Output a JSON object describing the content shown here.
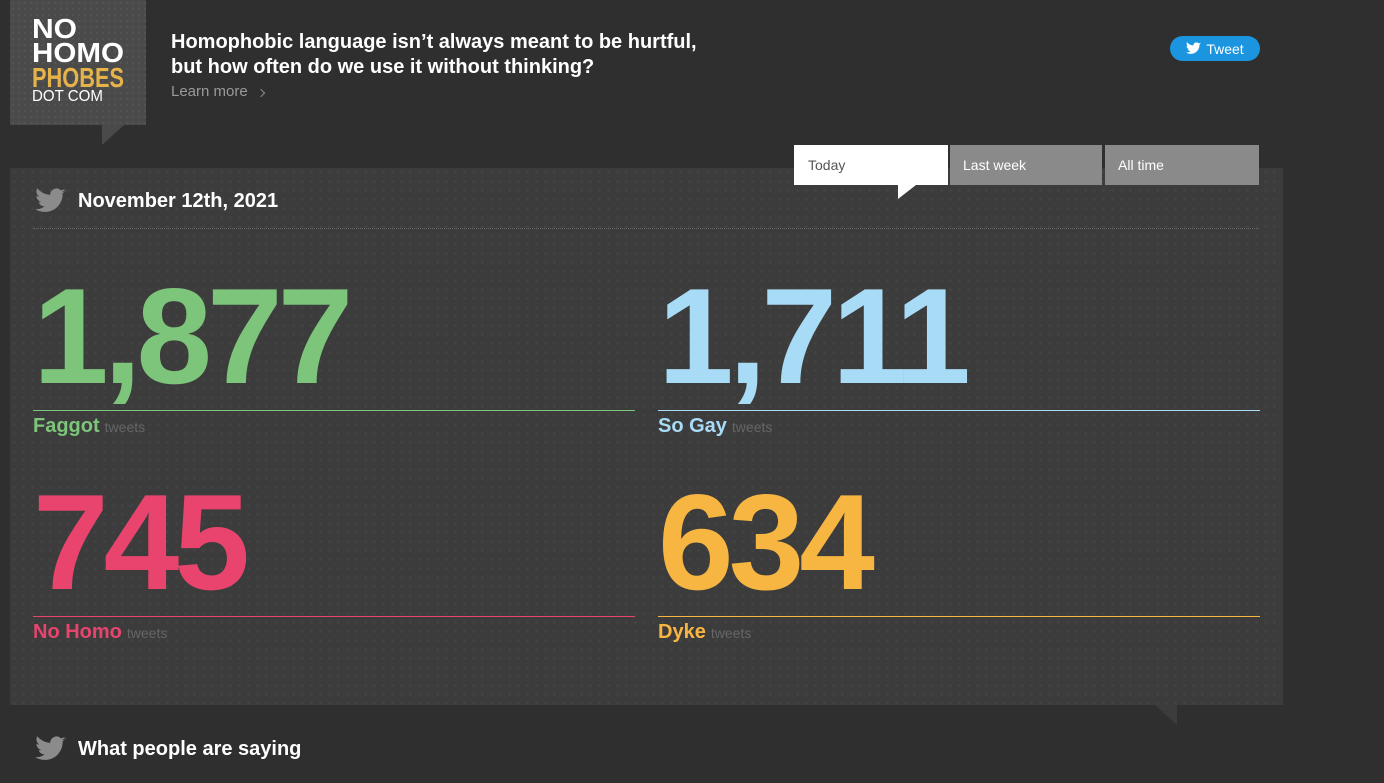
{
  "logo": {
    "line_1": "NO",
    "line_2": "HOMO",
    "line_3": "PHOBES",
    "line_4": "DOT COM",
    "accent_color": "#e6b34a"
  },
  "header": {
    "headline": [
      "Homophobic language isn’t always meant to be hurtful,",
      "but how often do we use it without thinking?"
    ],
    "learn_more": "Learn more",
    "learn_more_icon": "chevron-right-icon"
  },
  "tweet_button": {
    "label": "Tweet",
    "icon": "twitter-bird-icon",
    "color": "#1b95e0"
  },
  "tabs": {
    "items": [
      {
        "label": "Today",
        "selected": true
      },
      {
        "label": "Last week",
        "selected": false
      },
      {
        "label": "All time",
        "selected": false
      }
    ]
  },
  "stats_panel": {
    "icon": "twitter-bird-icon",
    "date": "November 12th, 2021",
    "stats": [
      {
        "count": "1,877",
        "term": "Faggot",
        "unit": "tweets",
        "color": "#7cc57a"
      },
      {
        "count": "1,711",
        "term": "So Gay",
        "unit": "tweets",
        "color": "#a8dbf6"
      },
      {
        "count": "745",
        "term": "No Homo",
        "unit": "tweets",
        "color": "#e9446e"
      },
      {
        "count": "634",
        "term": "Dyke",
        "unit": "tweets",
        "color": "#f7b642"
      }
    ]
  },
  "feed": {
    "icon": "twitter-bird-icon",
    "heading": "What people are saying"
  },
  "colors": {
    "page_background": "#2f2f2f",
    "panel_background": "#3c3c3c",
    "inactive_tab": "#8a8a8a",
    "icon_gray": "#8b8b8b"
  }
}
